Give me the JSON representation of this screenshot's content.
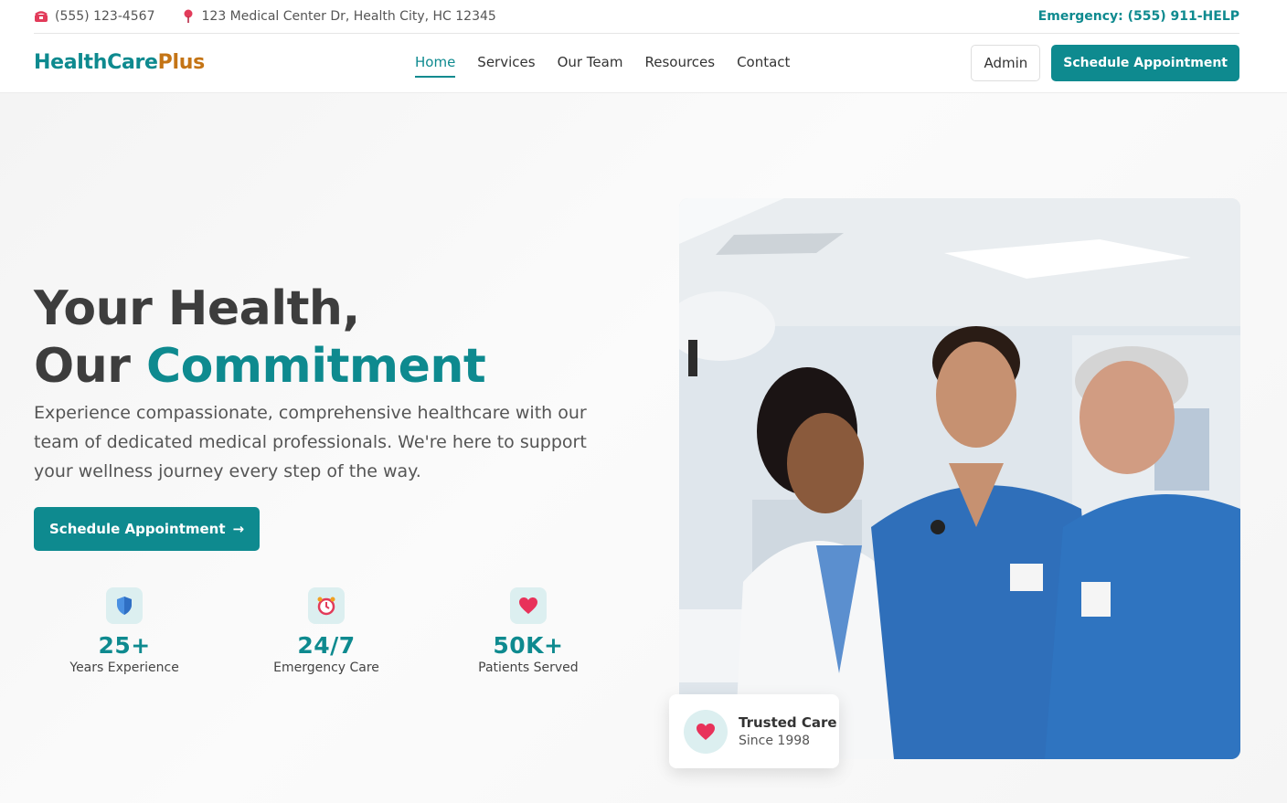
{
  "topbar": {
    "phone": "(555) 123-4567",
    "address": "123 Medical Center Dr, Health City, HC 12345",
    "emergency": "Emergency: (555) 911-HELP"
  },
  "header": {
    "logo_part1": "HealthCare",
    "logo_part2": "Plus",
    "nav": [
      "Home",
      "Services",
      "Our Team",
      "Resources",
      "Contact"
    ],
    "active_nav": "Home",
    "admin_label": "Admin",
    "schedule_label": "Schedule Appointment"
  },
  "hero": {
    "headline_line1": "Your Health,",
    "headline_line2_plain": "Our ",
    "headline_line2_accent": "Commitment",
    "lead": "Experience compassionate, comprehensive healthcare with our team of dedicated medical professionals. We're here to support your wellness journey every step of the way.",
    "cta_label": "Schedule Appointment",
    "cta_arrow": "→",
    "stats": [
      {
        "icon": "shield-icon",
        "value": "25+",
        "label": "Years Experience"
      },
      {
        "icon": "alarm-clock-icon",
        "value": "24/7",
        "label": "Emergency Care"
      },
      {
        "icon": "heart-icon",
        "value": "50K+",
        "label": "Patients Served"
      }
    ],
    "trusted_title": "Trusted Care",
    "trusted_sub": "Since 1998"
  },
  "colors": {
    "brand": "#0e8a8f",
    "logo_accent": "#c47415",
    "heading": "#3d3d3d"
  }
}
